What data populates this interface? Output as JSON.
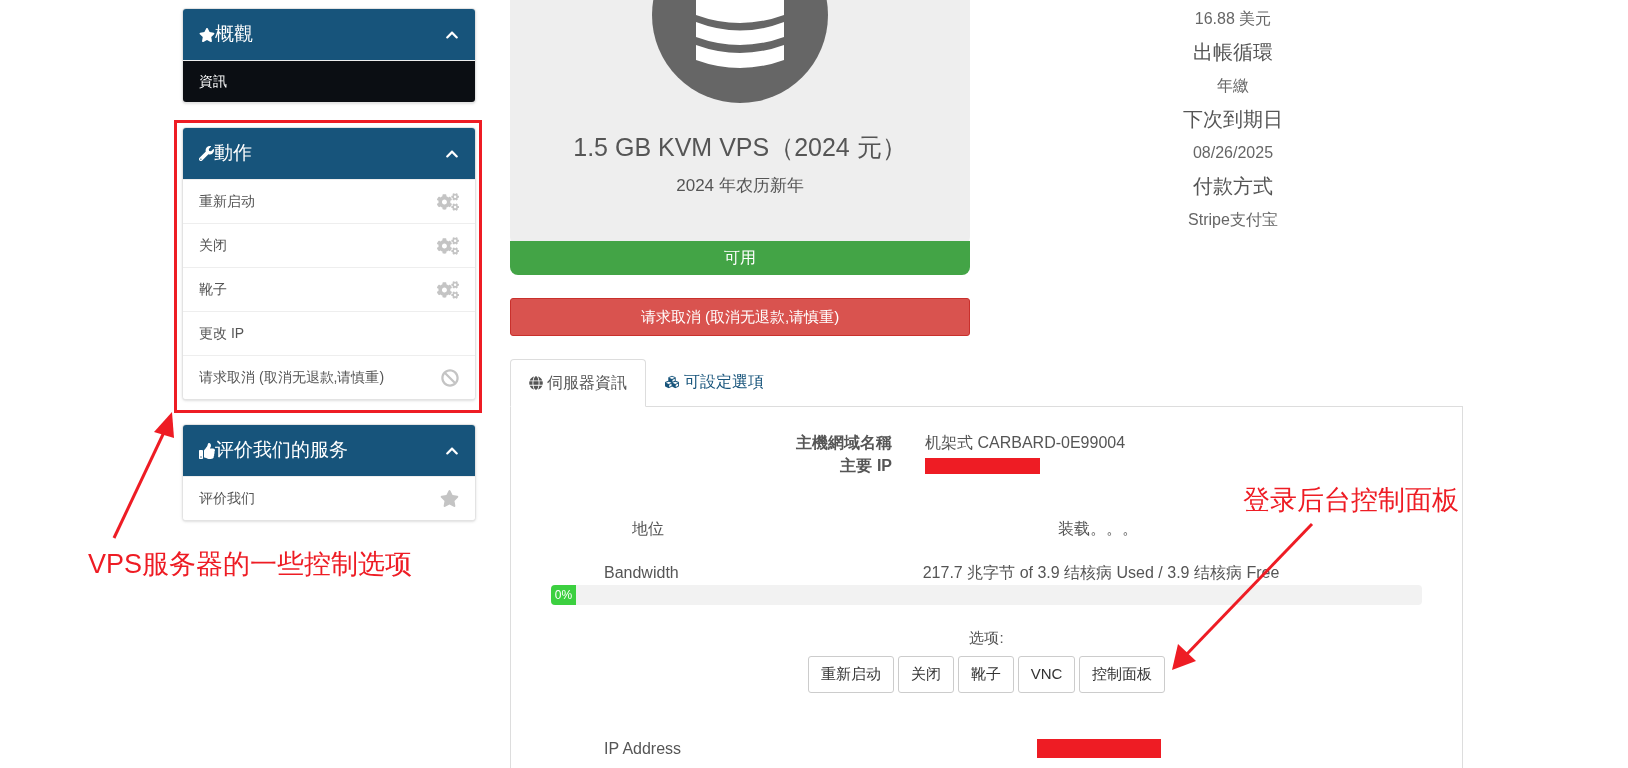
{
  "sidebar": {
    "panels": [
      {
        "kind": "overview",
        "title": "概觀",
        "expanded": true,
        "highlighted": false,
        "items": [
          {
            "kind": "plain",
            "label": "資訊",
            "selected": true
          }
        ]
      },
      {
        "kind": "actions",
        "title": "動作",
        "expanded": true,
        "highlighted": true,
        "items": [
          {
            "kind": "action",
            "label": "重新启动",
            "selected": false
          },
          {
            "kind": "action",
            "label": "关闭",
            "selected": false
          },
          {
            "kind": "action",
            "label": "靴子",
            "selected": false
          },
          {
            "kind": "plain",
            "label": "更改 IP",
            "selected": false
          },
          {
            "kind": "cancel",
            "label": "请求取消 (取消无退款,请慎重)",
            "selected": false
          }
        ]
      },
      {
        "kind": "review",
        "title": "评价我们的服务",
        "expanded": true,
        "highlighted": false,
        "items": [
          {
            "kind": "review",
            "label": "评价我们",
            "selected": false
          }
        ]
      }
    ]
  },
  "product": {
    "name": "1.5 GB KVM VPS（2024 元）",
    "group": "2024 年农历新年",
    "status": {
      "kind": "active",
      "text": "可用"
    }
  },
  "cancel_button": "请求取消 (取消无退款,请慎重)",
  "details": [
    {
      "kind": "value",
      "text": "16.88 美元"
    },
    {
      "kind": "label",
      "text": "出帳循環"
    },
    {
      "kind": "value",
      "text": "年繳"
    },
    {
      "kind": "label",
      "text": "下次到期日"
    },
    {
      "kind": "value",
      "text": "08/26/2025"
    },
    {
      "kind": "label",
      "text": "付款方式"
    },
    {
      "kind": "value",
      "text": "Stripe支付宝"
    }
  ],
  "tabs": [
    {
      "kind": "globe",
      "label": "伺服器資訊",
      "selected": true
    },
    {
      "kind": "cubes",
      "label": "可設定選項",
      "selected": false
    }
  ],
  "server": [
    {
      "label": "主機網域名稱",
      "value": "机架式 CARBARD-0E99004",
      "redacted": false
    },
    {
      "label": "主要 IP",
      "redacted": true
    }
  ],
  "status_row": {
    "label": "地位",
    "value": "装载。。。"
  },
  "bandwidth": {
    "label": "Bandwidth",
    "reading": "217.7 兆字节 of 3.9 结核病 Used / 3.9 结核病 Free",
    "level": 0,
    "percent": "0%"
  },
  "options": {
    "label": "选项:",
    "buttons": [
      "重新启动",
      "关闭",
      "靴子",
      "VNC",
      "控制面板"
    ]
  },
  "ip": {
    "label": "IP Address",
    "redacted": true
  },
  "annotations": [
    {
      "kind": "left",
      "text": "VPS服务器的一些控制选项"
    },
    {
      "kind": "right",
      "text": "登录后台控制面板"
    }
  ]
}
